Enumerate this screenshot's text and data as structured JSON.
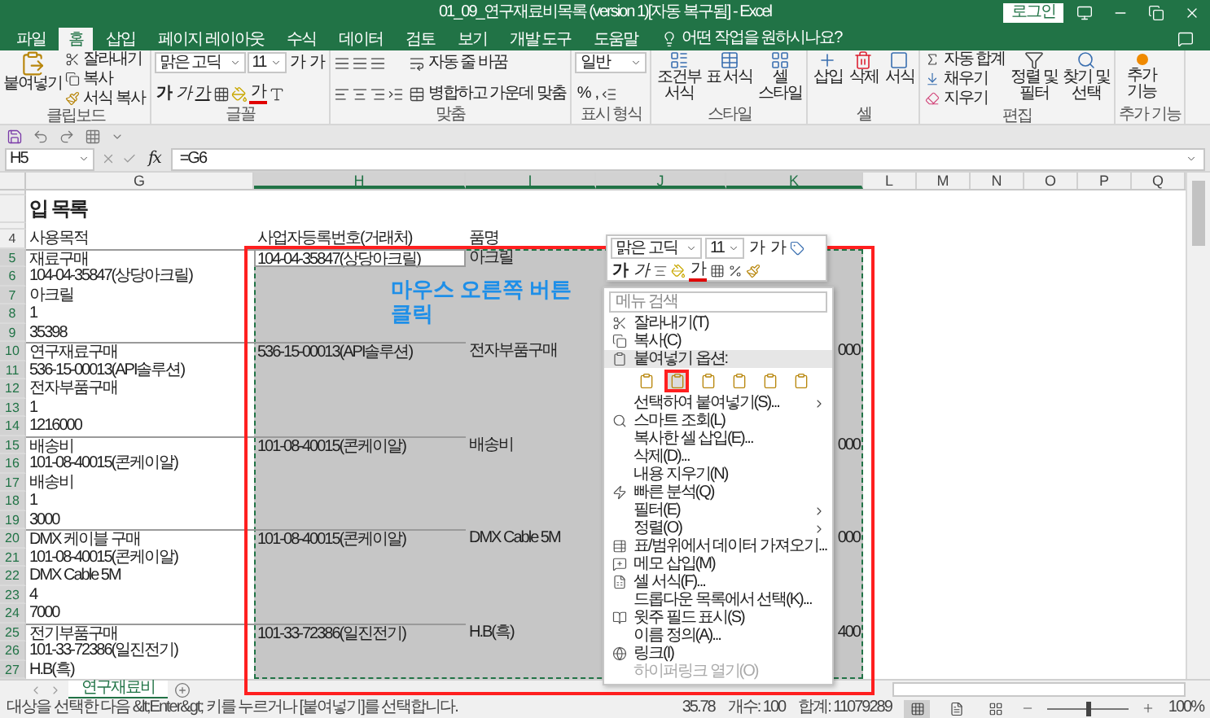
{
  "window": {
    "title": "01_09_연구재료비목록 (version 1)[자동 복구됨] - Excel",
    "login": "로그인"
  },
  "ribbon_tabs": [
    {
      "label": "파일",
      "selected": false
    },
    {
      "label": "홈",
      "selected": true
    },
    {
      "label": "삽입",
      "selected": false
    },
    {
      "label": "페이지 레이아웃",
      "selected": false
    },
    {
      "label": "수식",
      "selected": false
    },
    {
      "label": "데이터",
      "selected": false
    },
    {
      "label": "검토",
      "selected": false
    },
    {
      "label": "보기",
      "selected": false
    },
    {
      "label": "개발 도구",
      "selected": false
    },
    {
      "label": "도움말",
      "selected": false
    }
  ],
  "tell_me": "어떤 작업을 원하시나요?",
  "clipboard": {
    "paste": "붙여넣기",
    "cut": "잘라내기",
    "copy": "복사",
    "format_painter": "서식 복사",
    "label": "클립보드"
  },
  "font": {
    "name": "맑은 고딕",
    "size": "11",
    "grow": "가",
    "shrink": "가",
    "bold": "가",
    "italic": "가",
    "underline": "가",
    "font_color": "가",
    "label": "글꼴"
  },
  "alignment": {
    "wrap": "자동 줄 바꿈",
    "merge": "병합하고 가운데 맞춤",
    "label": "맞춤"
  },
  "number": {
    "format": "일반",
    "percent": "%",
    "comma": ",",
    "label": "표시 형식"
  },
  "styles": {
    "buttons": [
      "조건부 서식",
      "표 서식",
      "셀 스타일"
    ],
    "label": "스타일"
  },
  "cells": {
    "buttons": [
      "삽입",
      "삭제",
      "서식"
    ],
    "label": "셀"
  },
  "editing": {
    "autosum": "자동 합계",
    "fill": "채우기",
    "clear": "지우기",
    "sort": "정렬 및 필터",
    "find": "찾기 및 선택",
    "label": "편집"
  },
  "addins": {
    "button": "추가 기능",
    "label": "추가 기능"
  },
  "formula_bar": {
    "name_box": "H5",
    "fx": "fx",
    "formula": "=G6"
  },
  "sheet": {
    "heading": "입 목록",
    "columns": [
      {
        "label": "G",
        "selected": false
      },
      {
        "label": "H",
        "selected": true
      },
      {
        "label": "I",
        "selected": true
      },
      {
        "label": "J",
        "selected": true
      },
      {
        "label": "K",
        "selected": true
      },
      {
        "label": "L",
        "selected": false
      },
      {
        "label": "M",
        "selected": false
      },
      {
        "label": "N",
        "selected": false
      },
      {
        "label": "O",
        "selected": false
      },
      {
        "label": "P",
        "selected": false
      },
      {
        "label": "Q",
        "selected": false
      }
    ],
    "rows": [
      {
        "number": "4",
        "selected": false,
        "active": false,
        "g": "사용목적",
        "h": "사업자등록번호(거래처)",
        "i": "품명"
      },
      {
        "number": "5",
        "selected": true,
        "active": true,
        "g": "재료구매",
        "h": "104-04-35847(상당아크릴)",
        "i": "아크릴"
      },
      {
        "number": "6",
        "selected": true,
        "active": false,
        "g": "104-04-35847(상당아크릴)"
      },
      {
        "number": "7",
        "selected": true,
        "active": false,
        "g": "아크릴"
      },
      {
        "number": "8",
        "selected": true,
        "active": false,
        "g": "1"
      },
      {
        "number": "9",
        "selected": true,
        "active": false,
        "g": "35398"
      },
      {
        "number": "10",
        "selected": true,
        "active": false,
        "g": "연구재료구매",
        "h": "536-15-00013(API솔루션)",
        "i": "전자부품구매",
        "k": "000"
      },
      {
        "number": "11",
        "selected": true,
        "active": false,
        "g": "536-15-00013(API솔루션)"
      },
      {
        "number": "12",
        "selected": true,
        "active": false,
        "g": "전자부품구매"
      },
      {
        "number": "13",
        "selected": true,
        "active": false,
        "g": "1"
      },
      {
        "number": "14",
        "selected": true,
        "active": false,
        "g": "1216000"
      },
      {
        "number": "15",
        "selected": true,
        "active": false,
        "g": "배송비",
        "h": "101-08-40015(콘케이알)",
        "i": "배송비",
        "k": "000"
      },
      {
        "number": "16",
        "selected": true,
        "active": false,
        "g": "101-08-40015(콘케이알)"
      },
      {
        "number": "17",
        "selected": true,
        "active": false,
        "g": "배송비"
      },
      {
        "number": "18",
        "selected": true,
        "active": false,
        "g": "1"
      },
      {
        "number": "19",
        "selected": true,
        "active": false,
        "g": "3000"
      },
      {
        "number": "20",
        "selected": true,
        "active": false,
        "g": "DMX 케이블 구매",
        "h": "101-08-40015(콘케이알)",
        "i": "DMX Cable 5M",
        "k": "000"
      },
      {
        "number": "21",
        "selected": true,
        "active": false,
        "g": "101-08-40015(콘케이알)"
      },
      {
        "number": "22",
        "selected": true,
        "active": false,
        "g": "DMX Cable 5M"
      },
      {
        "number": "23",
        "selected": true,
        "active": false,
        "g": "4"
      },
      {
        "number": "24",
        "selected": true,
        "active": false,
        "g": "7000"
      },
      {
        "number": "25",
        "selected": true,
        "active": false,
        "g": "전기부품구매",
        "h": "101-33-72386(일진전기)",
        "i": "H.B(흑)",
        "k": "400"
      },
      {
        "number": "26",
        "selected": true,
        "active": false,
        "g": "101-33-72386(일진전기)"
      },
      {
        "number": "27",
        "selected": true,
        "active": false,
        "g": "H.B(흑)"
      }
    ]
  },
  "annotation": {
    "text": "마우스 오른쪽 버튼 클릭"
  },
  "mini_toolbar": {
    "font": "맑은 고딕",
    "size": "11",
    "grow": "가",
    "shrink": "가",
    "bold": "가",
    "italic": "가",
    "font_color": "가"
  },
  "context_menu": {
    "search_placeholder": "메뉴 검색",
    "items": [
      {
        "kind": "item",
        "label": "잘라내기(T)",
        "disabled": false
      },
      {
        "kind": "item",
        "label": "복사(C)",
        "disabled": false
      },
      {
        "kind": "header",
        "label": "붙여넣기 옵션:",
        "disabled": false
      },
      {
        "kind": "paste_options",
        "disabled": false,
        "options": [
          {
            "selected": false
          },
          {
            "selected": true
          },
          {
            "selected": false
          },
          {
            "selected": false
          },
          {
            "selected": false
          },
          {
            "selected": false
          }
        ]
      },
      {
        "kind": "submenu",
        "label": "선택하여 붙여넣기(S)...",
        "disabled": false
      },
      {
        "kind": "item",
        "label": "스마트 조회(L)",
        "disabled": false
      },
      {
        "kind": "item",
        "label": "복사한 셀 삽입(E)...",
        "disabled": false
      },
      {
        "kind": "item",
        "label": "삭제(D)...",
        "disabled": false
      },
      {
        "kind": "item",
        "label": "내용 지우기(N)",
        "disabled": false
      },
      {
        "kind": "item",
        "label": "빠른 분석(Q)",
        "disabled": false
      },
      {
        "kind": "submenu",
        "label": "필터(E)",
        "disabled": false
      },
      {
        "kind": "submenu",
        "label": "정렬(O)",
        "disabled": false
      },
      {
        "kind": "item",
        "label": "표/범위에서 데이터 가져오기...",
        "disabled": false
      },
      {
        "kind": "item",
        "label": "메모 삽입(M)",
        "disabled": false
      },
      {
        "kind": "item",
        "label": "셀 서식(F)...",
        "disabled": false
      },
      {
        "kind": "item",
        "label": "드롭다운 목록에서 선택(K)...",
        "disabled": false
      },
      {
        "kind": "item",
        "label": "윗주 필드 표시(S)",
        "disabled": false
      },
      {
        "kind": "item",
        "label": "이름 정의(A)...",
        "disabled": false
      },
      {
        "kind": "item",
        "label": "링크(I)",
        "disabled": false
      },
      {
        "kind": "item",
        "label": "하이퍼링크 열기(O)",
        "disabled": true
      }
    ]
  },
  "sheet_tabs": [
    {
      "label": "연구재료비",
      "selected": true
    }
  ],
  "status_bar": {
    "message": "대상을 선택한 다음 &lt;Enter&gt; 키를 누르거나 [붙여넣기]를 선택합니다.",
    "average": "35.78",
    "count": "개수: 100",
    "sum": "합계: 11079289",
    "zoom": "100%",
    "level": 0.5
  }
}
